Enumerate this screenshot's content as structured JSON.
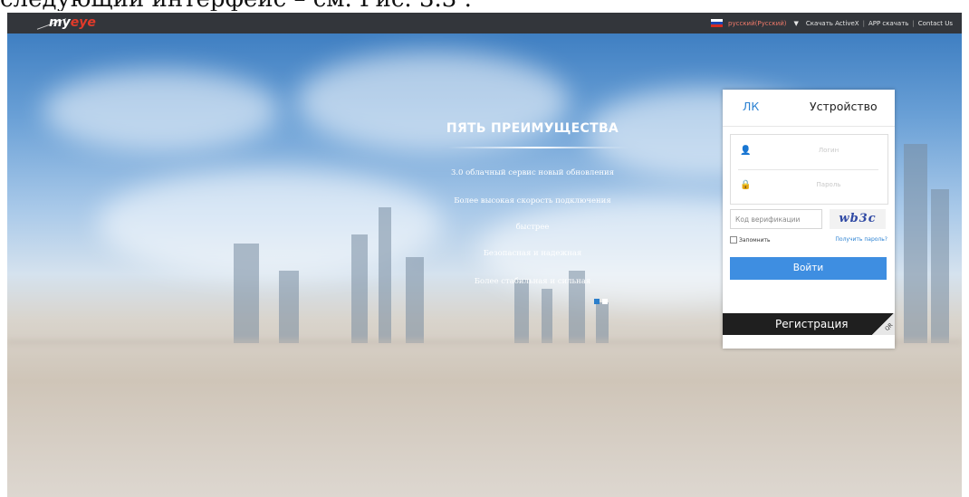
{
  "caption": "следующий интерфейс – см. Рис. 3.3 .",
  "header": {
    "logo_text_1": "my",
    "logo_text_2": "eye",
    "language": "русский(Русский)",
    "links": [
      "Скачать ActiveX",
      "APP скачать",
      "Contact Us"
    ]
  },
  "advantages": {
    "title": "ПЯТЬ ПРЕИМУЩЕСТВА",
    "items": [
      "3.0 облачный сервис новый обновления",
      "Более высокая скорость подключения",
      "быстрее",
      "Безопасная и надежная",
      "Более стабильная и сильная"
    ]
  },
  "login": {
    "tab_active": "ЛК",
    "tab_other": "Устройство",
    "login_placeholder": "Логин",
    "password_placeholder": "Пароль",
    "captcha_placeholder": "Код верификации",
    "captcha_text": "wb3c",
    "remember": "Запомнить",
    "forgot": "Получить пароль?",
    "submit": "Войти",
    "register": "Регистрация",
    "corner_text": "QR"
  },
  "colors": {
    "accent": "#3e8ee1",
    "topbar": "#33363b",
    "register_bg": "#1f1f1f"
  }
}
